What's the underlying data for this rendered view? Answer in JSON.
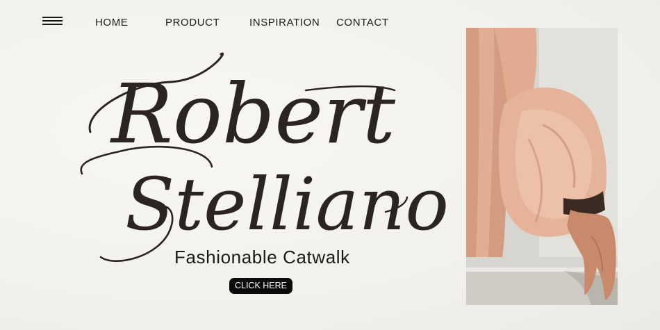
{
  "nav": {
    "menu_icon": "hamburger-menu-icon",
    "links": [
      "HOME",
      "PRODUCT",
      "INSPIRATION",
      "CONTACT"
    ]
  },
  "hero": {
    "title_line1": "Robert",
    "title_line2": "Stelliano",
    "tagline": "Fashionable Catwalk",
    "cta_label": "CLICK HERE"
  },
  "photo": {
    "subject": "hand with peach chiffon puff sleeve"
  },
  "colors": {
    "background": "#f4f3f0",
    "script": "#2b2421",
    "button": "#0b0b0b",
    "fabric": "#d9a58a",
    "skin": "#c98c6c",
    "wall": "#dedcd6"
  }
}
